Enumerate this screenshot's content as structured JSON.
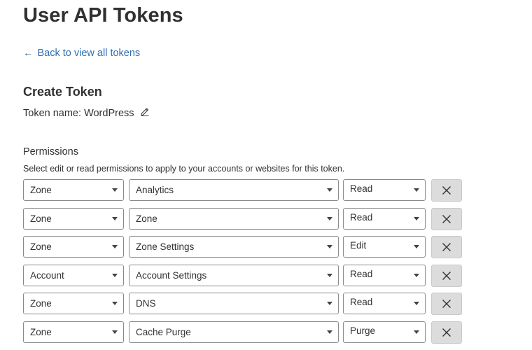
{
  "page": {
    "title": "User API Tokens",
    "back_link": "Back to view all tokens"
  },
  "create": {
    "title": "Create Token",
    "token_name_label": "Token name:",
    "token_name_value": "WordPress"
  },
  "permissions": {
    "label": "Permissions",
    "description": "Select edit or read permissions to apply to your accounts or websites for this token.",
    "rows": [
      {
        "scope": "Zone",
        "item": "Analytics",
        "permission": "Read"
      },
      {
        "scope": "Zone",
        "item": "Zone",
        "permission": "Read"
      },
      {
        "scope": "Zone",
        "item": "Zone Settings",
        "permission": "Edit"
      },
      {
        "scope": "Account",
        "item": "Account Settings",
        "permission": "Read"
      },
      {
        "scope": "Zone",
        "item": "DNS",
        "permission": "Read"
      },
      {
        "scope": "Zone",
        "item": "Cache Purge",
        "permission": "Purge"
      }
    ]
  },
  "icons": {
    "back": "arrow-left-icon",
    "edit": "pencil-icon",
    "dropdown": "chevron-down-icon",
    "remove": "close-icon"
  },
  "colors": {
    "link": "#2f6fb3",
    "remove_button_bg": "#dcdcdc",
    "select_border": "#8a8a8a"
  }
}
